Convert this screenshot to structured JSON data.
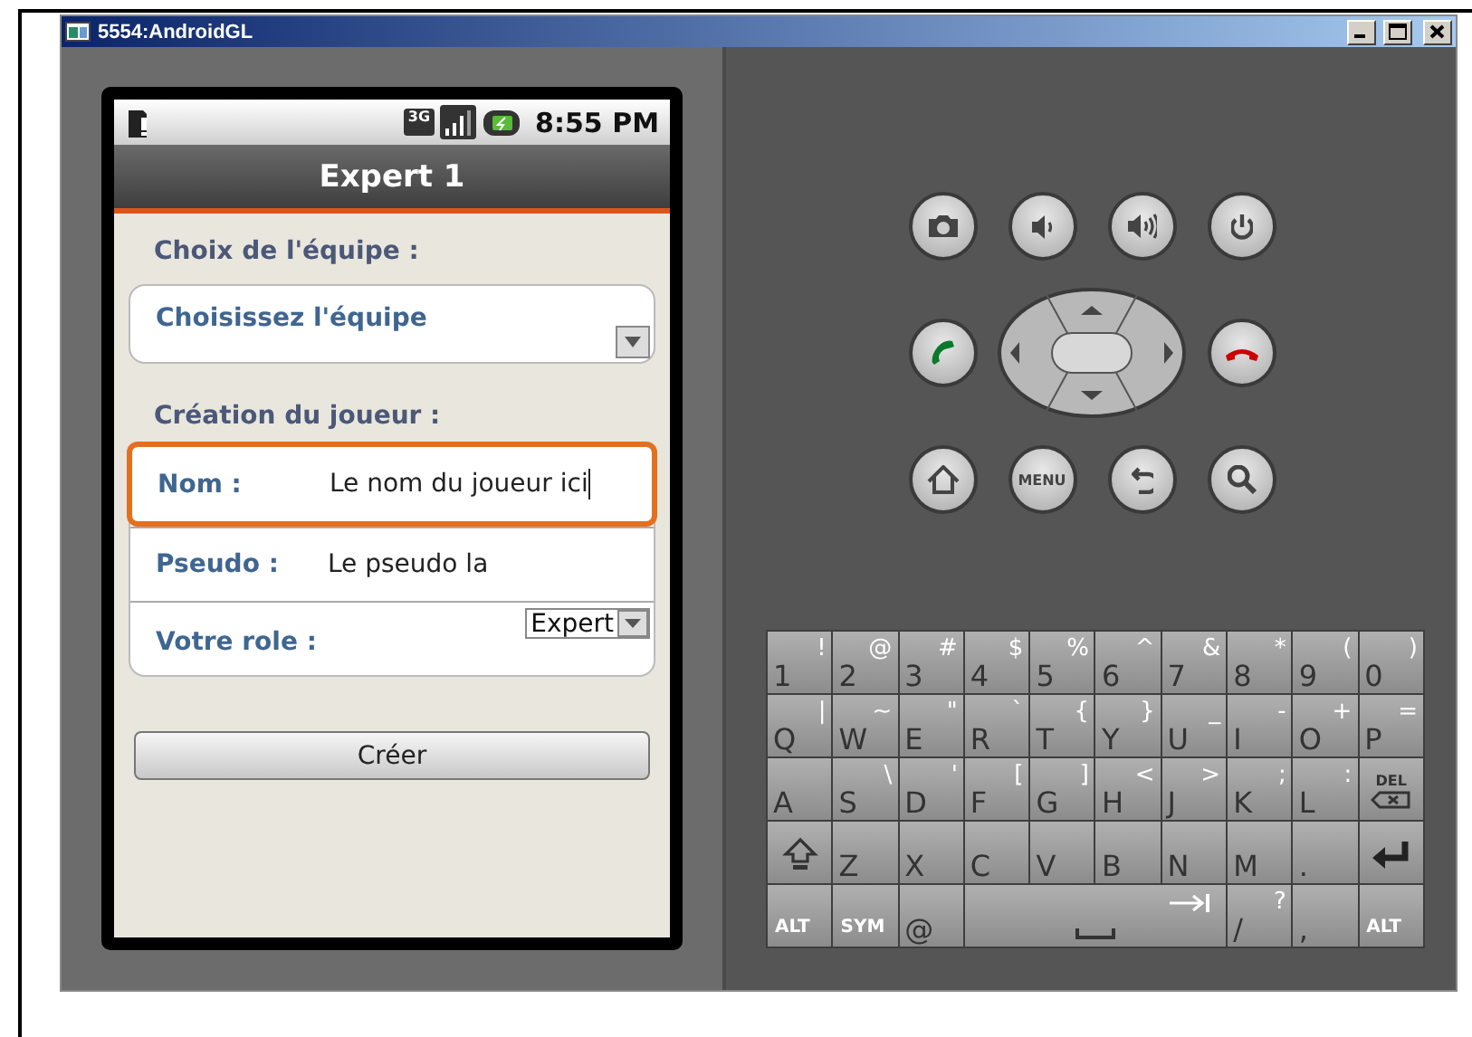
{
  "window": {
    "title": "5554:AndroidGL"
  },
  "status_bar": {
    "network": "3G",
    "time": "8:55 PM"
  },
  "app_bar": {
    "title": "Expert 1"
  },
  "team_section": {
    "label": "Choix de l'équipe :",
    "spinner": {
      "value": "Choisissez l'équipe"
    }
  },
  "player_section": {
    "label": "Création du joueur :",
    "fields": [
      {
        "kind": "text",
        "label": "Nom :",
        "value": "Le nom du joueur ici",
        "focused": true
      },
      {
        "kind": "text",
        "label": "Pseudo :",
        "value": "Le pseudo la",
        "focused": false
      },
      {
        "kind": "select",
        "label": "Votre role :",
        "value": "Expert",
        "focused": false
      }
    ]
  },
  "create_button": "Créer",
  "hardware_keys": {
    "menu_label": "MENU"
  },
  "keyboard": {
    "rows": [
      [
        {
          "kind": "char",
          "main": "1",
          "alt": "!"
        },
        {
          "kind": "char",
          "main": "2",
          "alt": "@"
        },
        {
          "kind": "char",
          "main": "3",
          "alt": "#"
        },
        {
          "kind": "char",
          "main": "4",
          "alt": "$"
        },
        {
          "kind": "char",
          "main": "5",
          "alt": "%"
        },
        {
          "kind": "char",
          "main": "6",
          "alt": "^"
        },
        {
          "kind": "char",
          "main": "7",
          "alt": "&"
        },
        {
          "kind": "char",
          "main": "8",
          "alt": "*"
        },
        {
          "kind": "char",
          "main": "9",
          "alt": "("
        },
        {
          "kind": "char",
          "main": "0",
          "alt": ")"
        }
      ],
      [
        {
          "kind": "char",
          "main": "Q",
          "alt": "|"
        },
        {
          "kind": "char",
          "main": "W",
          "alt": "~"
        },
        {
          "kind": "char",
          "main": "E",
          "alt": "\""
        },
        {
          "kind": "char",
          "main": "R",
          "alt": "`"
        },
        {
          "kind": "char",
          "main": "T",
          "alt": "{"
        },
        {
          "kind": "char",
          "main": "Y",
          "alt": "}"
        },
        {
          "kind": "char",
          "main": "U",
          "alt": "_"
        },
        {
          "kind": "char",
          "main": "I",
          "alt": "-"
        },
        {
          "kind": "char",
          "main": "O",
          "alt": "+"
        },
        {
          "kind": "char",
          "main": "P",
          "alt": "="
        }
      ],
      [
        {
          "kind": "char",
          "main": "A"
        },
        {
          "kind": "char",
          "main": "S",
          "alt": "\\"
        },
        {
          "kind": "char",
          "main": "D",
          "alt": "'"
        },
        {
          "kind": "char",
          "main": "F",
          "alt": "["
        },
        {
          "kind": "char",
          "main": "G",
          "alt": "]"
        },
        {
          "kind": "char",
          "main": "H",
          "alt": "<"
        },
        {
          "kind": "char",
          "main": "J",
          "alt": ">"
        },
        {
          "kind": "char",
          "main": "K",
          "alt": ";"
        },
        {
          "kind": "char",
          "main": "L",
          "alt": ":"
        },
        {
          "kind": "del",
          "main": "DEL"
        }
      ],
      [
        {
          "kind": "shift"
        },
        {
          "kind": "char",
          "main": "Z"
        },
        {
          "kind": "char",
          "main": "X"
        },
        {
          "kind": "char",
          "main": "C"
        },
        {
          "kind": "char",
          "main": "V"
        },
        {
          "kind": "char",
          "main": "B"
        },
        {
          "kind": "char",
          "main": "N"
        },
        {
          "kind": "char",
          "main": "M"
        },
        {
          "kind": "char",
          "main": "."
        },
        {
          "kind": "enter"
        }
      ]
    ],
    "bottom_row": [
      {
        "kind": "mod",
        "main": "ALT"
      },
      {
        "kind": "mod",
        "main": "SYM"
      },
      {
        "kind": "char",
        "main": "@"
      },
      {
        "kind": "space"
      },
      {
        "kind": "char",
        "main": "/",
        "alt": "?"
      },
      {
        "kind": "char",
        "main": ","
      },
      {
        "kind": "mod",
        "main": "ALT"
      }
    ]
  }
}
